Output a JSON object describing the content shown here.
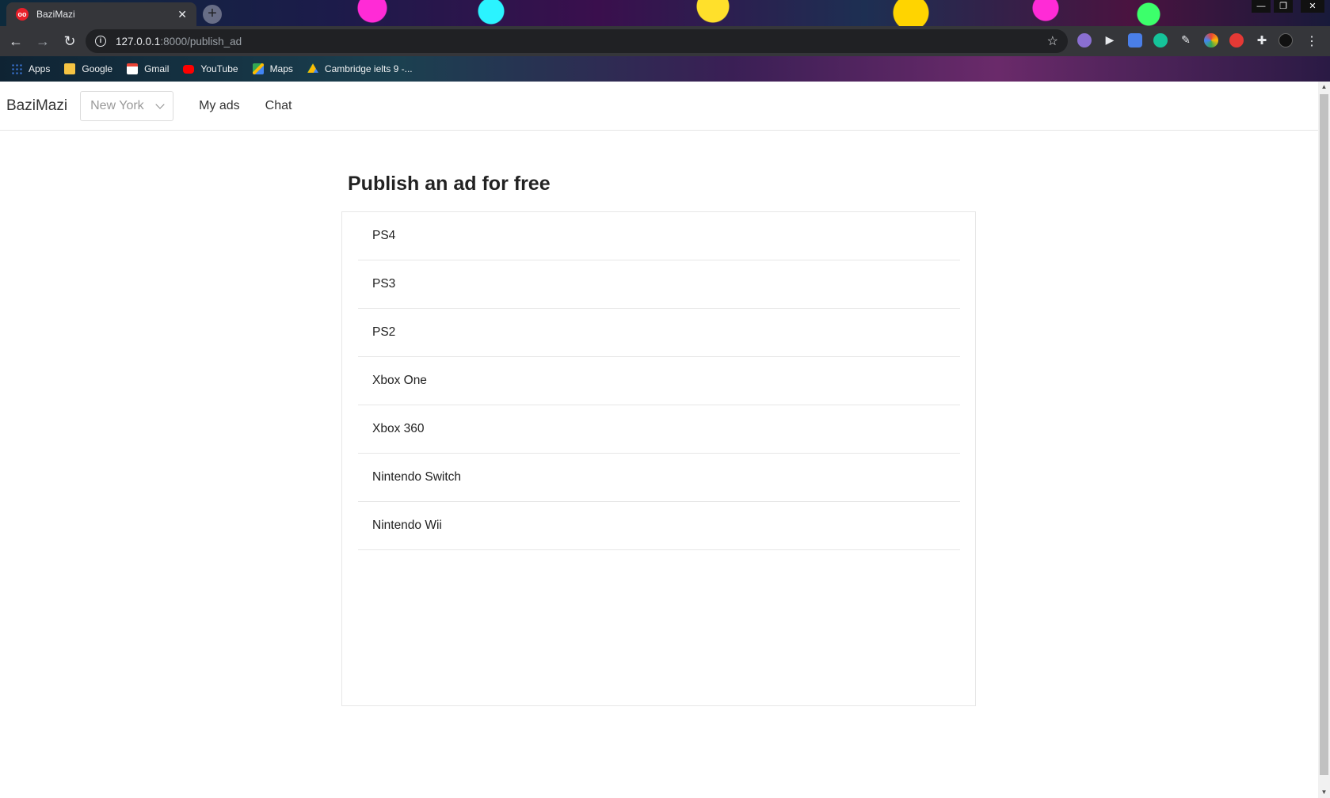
{
  "browser": {
    "tab_title": "BaziMazi",
    "tab_close": "✕",
    "new_tab": "+",
    "favicon": "oo",
    "url_host": "127.0.0.1",
    "url_path": ":8000/publish_ad",
    "bookmarks": [
      {
        "label": "Apps",
        "icon": "apps-grid-icon",
        "color": "#4285f4"
      },
      {
        "label": "Google",
        "icon": "folder-icon",
        "color": "#f6c443"
      },
      {
        "label": "Gmail",
        "icon": "gmail-icon",
        "color": "#ea4335"
      },
      {
        "label": "YouTube",
        "icon": "youtube-icon",
        "color": "#ff0000"
      },
      {
        "label": "Maps",
        "icon": "maps-icon",
        "color": "#34a853"
      },
      {
        "label": "Cambridge ielts 9 -...",
        "icon": "drive-icon",
        "color": "#fbbc04"
      }
    ]
  },
  "site": {
    "brand": "BaziMazi",
    "city": "New York",
    "nav": {
      "my_ads": "My ads",
      "chat": "Chat"
    }
  },
  "main": {
    "title": "Publish an ad for free",
    "categories": [
      "PS4",
      "PS3",
      "PS2",
      "Xbox One",
      "Xbox 360",
      "Nintendo Switch",
      "Nintendo Wii"
    ]
  }
}
